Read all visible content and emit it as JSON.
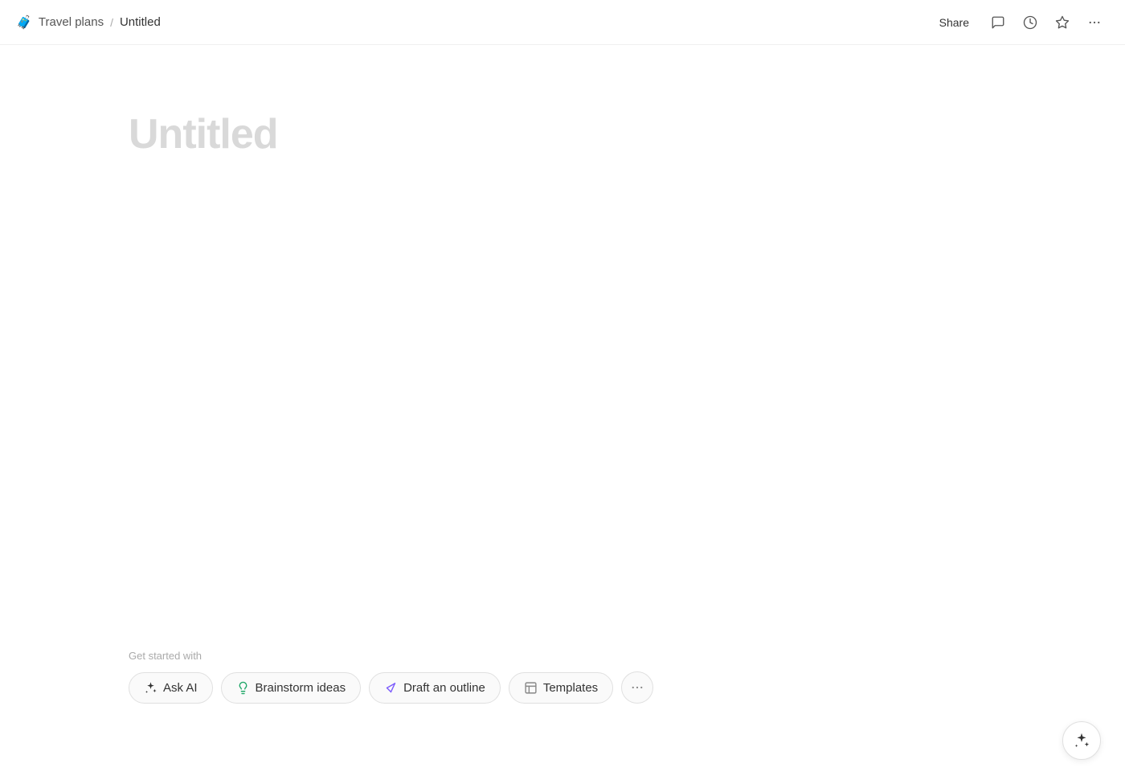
{
  "header": {
    "breadcrumb": {
      "emoji": "🧳",
      "parent": "Travel plans",
      "separator": "/",
      "current": "Untitled"
    },
    "actions": {
      "share_label": "Share"
    }
  },
  "editor": {
    "title_placeholder": "Untitled"
  },
  "toolbar": {
    "get_started_label": "Get started with",
    "buttons": [
      {
        "id": "ask-ai",
        "label": "Ask AI",
        "icon": "sparkle"
      },
      {
        "id": "brainstorm",
        "label": "Brainstorm ideas",
        "icon": "bulb"
      },
      {
        "id": "draft-outline",
        "label": "Draft an outline",
        "icon": "pencil"
      },
      {
        "id": "templates",
        "label": "Templates",
        "icon": "template"
      }
    ],
    "more_label": "···"
  },
  "fab": {
    "icon": "sparkle",
    "label": "AI assistant"
  }
}
